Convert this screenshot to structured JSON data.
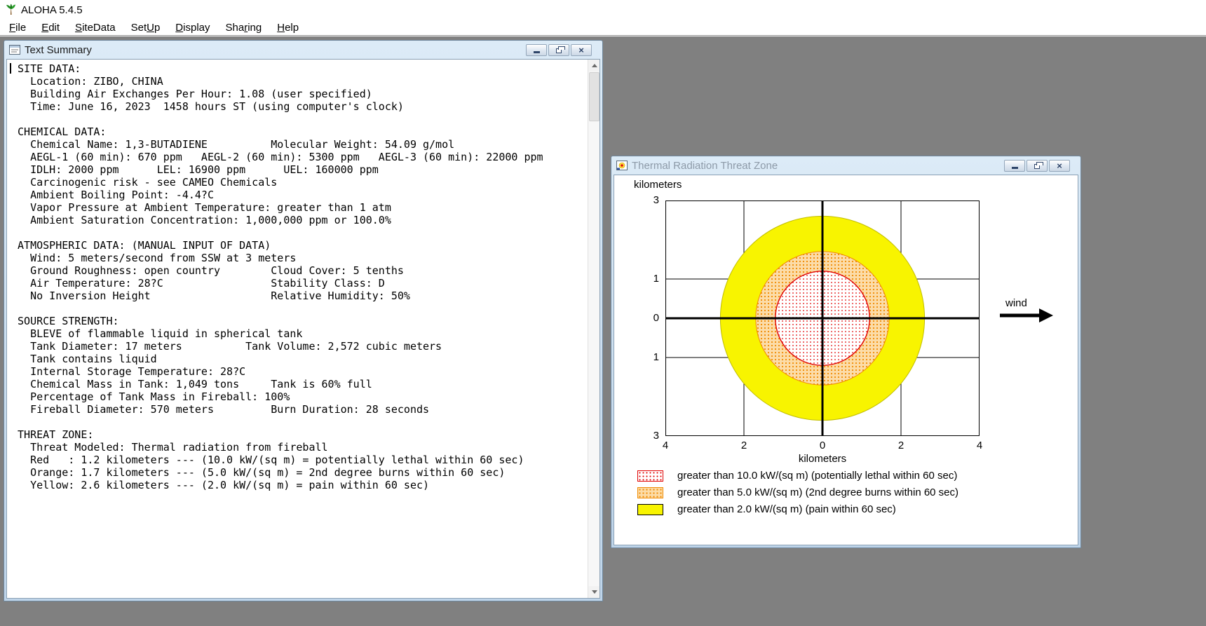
{
  "app": {
    "title": "ALOHA 5.4.5",
    "menu": [
      {
        "pre": "",
        "accel": "F",
        "post": "ile"
      },
      {
        "pre": "",
        "accel": "E",
        "post": "dit"
      },
      {
        "pre": "",
        "accel": "S",
        "post": "iteData"
      },
      {
        "pre": "Set",
        "accel": "U",
        "post": "p"
      },
      {
        "pre": "",
        "accel": "D",
        "post": "isplay"
      },
      {
        "pre": "Sha",
        "accel": "r",
        "post": "ing"
      },
      {
        "pre": "",
        "accel": "H",
        "post": "elp"
      }
    ]
  },
  "icons": {
    "close_glyph": "×",
    "app_icon": "palm-tree-icon",
    "text_summary_icon": "text-window-icon",
    "threat_icon": "threat-plot-icon"
  },
  "text_summary_window": {
    "title": "Text Summary",
    "lines": [
      " SITE DATA:",
      "   Location: ZIBO, CHINA",
      "   Building Air Exchanges Per Hour: 1.08 (user specified)",
      "   Time: June 16, 2023  1458 hours ST (using computer's clock)",
      "",
      " CHEMICAL DATA:",
      "   Chemical Name: 1,3-BUTADIENE          Molecular Weight: 54.09 g/mol",
      "   AEGL-1 (60 min): 670 ppm   AEGL-2 (60 min): 5300 ppm   AEGL-3 (60 min): 22000 ppm",
      "   IDLH: 2000 ppm      LEL: 16900 ppm      UEL: 160000 ppm",
      "   Carcinogenic risk - see CAMEO Chemicals",
      "   Ambient Boiling Point: -4.4?C",
      "   Vapor Pressure at Ambient Temperature: greater than 1 atm",
      "   Ambient Saturation Concentration: 1,000,000 ppm or 100.0%",
      "",
      " ATMOSPHERIC DATA: (MANUAL INPUT OF DATA)",
      "   Wind: 5 meters/second from SSW at 3 meters",
      "   Ground Roughness: open country        Cloud Cover: 5 tenths",
      "   Air Temperature: 28?C                 Stability Class: D",
      "   No Inversion Height                   Relative Humidity: 50%",
      "",
      " SOURCE STRENGTH:",
      "   BLEVE of flammable liquid in spherical tank",
      "   Tank Diameter: 17 meters          Tank Volume: 2,572 cubic meters",
      "   Tank contains liquid",
      "   Internal Storage Temperature: 28?C",
      "   Chemical Mass in Tank: 1,049 tons     Tank is 60% full",
      "   Percentage of Tank Mass in Fireball: 100%",
      "   Fireball Diameter: 570 meters         Burn Duration: 28 seconds",
      "",
      " THREAT ZONE:",
      "   Threat Modeled: Thermal radiation from fireball",
      "   Red   : 1.2 kilometers --- (10.0 kW/(sq m) = potentially lethal within 60 sec)",
      "   Orange: 1.7 kilometers --- (5.0 kW/(sq m) = 2nd degree burns within 60 sec)",
      "   Yellow: 2.6 kilometers --- (2.0 kW/(sq m) = pain within 60 sec)"
    ]
  },
  "threat_window": {
    "title": "Thermal Radiation Threat Zone",
    "y_axis_label": "kilometers",
    "x_axis_label": "kilometers",
    "wind_label": "wind",
    "y_ticks": [
      "3",
      "1",
      "0",
      "1",
      "3"
    ],
    "x_ticks": [
      "4",
      "2",
      "0",
      "2",
      "4"
    ],
    "legend": [
      {
        "swatch": "red-dots",
        "label": "greater than 10.0 kW/(sq m) (potentially lethal within 60 sec)"
      },
      {
        "swatch": "orange-dots",
        "label": "greater than 5.0 kW/(sq m) (2nd degree burns within 60 sec)"
      },
      {
        "swatch": "yellow-solid",
        "label": "greater than 2.0 kW/(sq m) (pain within 60 sec)"
      }
    ]
  },
  "chart_data": {
    "type": "area",
    "title": "Thermal Radiation Threat Zone",
    "xlabel": "kilometers",
    "ylabel": "kilometers",
    "xlim": [
      -4,
      4
    ],
    "ylim": [
      -3,
      3
    ],
    "grid": "on",
    "gridlines_x_km": [
      -2,
      0,
      2
    ],
    "gridlines_y_km": [
      -1,
      0,
      1
    ],
    "center_km": [
      0,
      0
    ],
    "zones": [
      {
        "name": "red",
        "radius_km": 1.2,
        "threshold": "10.0 kW/(sq m)",
        "effect": "potentially lethal within 60 sec",
        "color": "#e00000",
        "fill_style": "red dots on white"
      },
      {
        "name": "orange",
        "radius_km": 1.7,
        "threshold": "5.0 kW/(sq m)",
        "effect": "2nd degree burns within 60 sec",
        "color": "#f08a00",
        "fill_style": "orange stipple"
      },
      {
        "name": "yellow",
        "radius_km": 2.6,
        "threshold": "2.0 kW/(sq m)",
        "effect": "pain within 60 sec",
        "color": "#f8f400",
        "fill_style": "solid yellow"
      }
    ],
    "wind_arrow": {
      "label": "wind",
      "direction": "right"
    },
    "legend_position": "below plot, left aligned"
  },
  "colors": {
    "desktop_gray": "#808080",
    "zone_red": "#e00000",
    "zone_orange": "#f08a00",
    "zone_yellow": "#f8f400"
  }
}
